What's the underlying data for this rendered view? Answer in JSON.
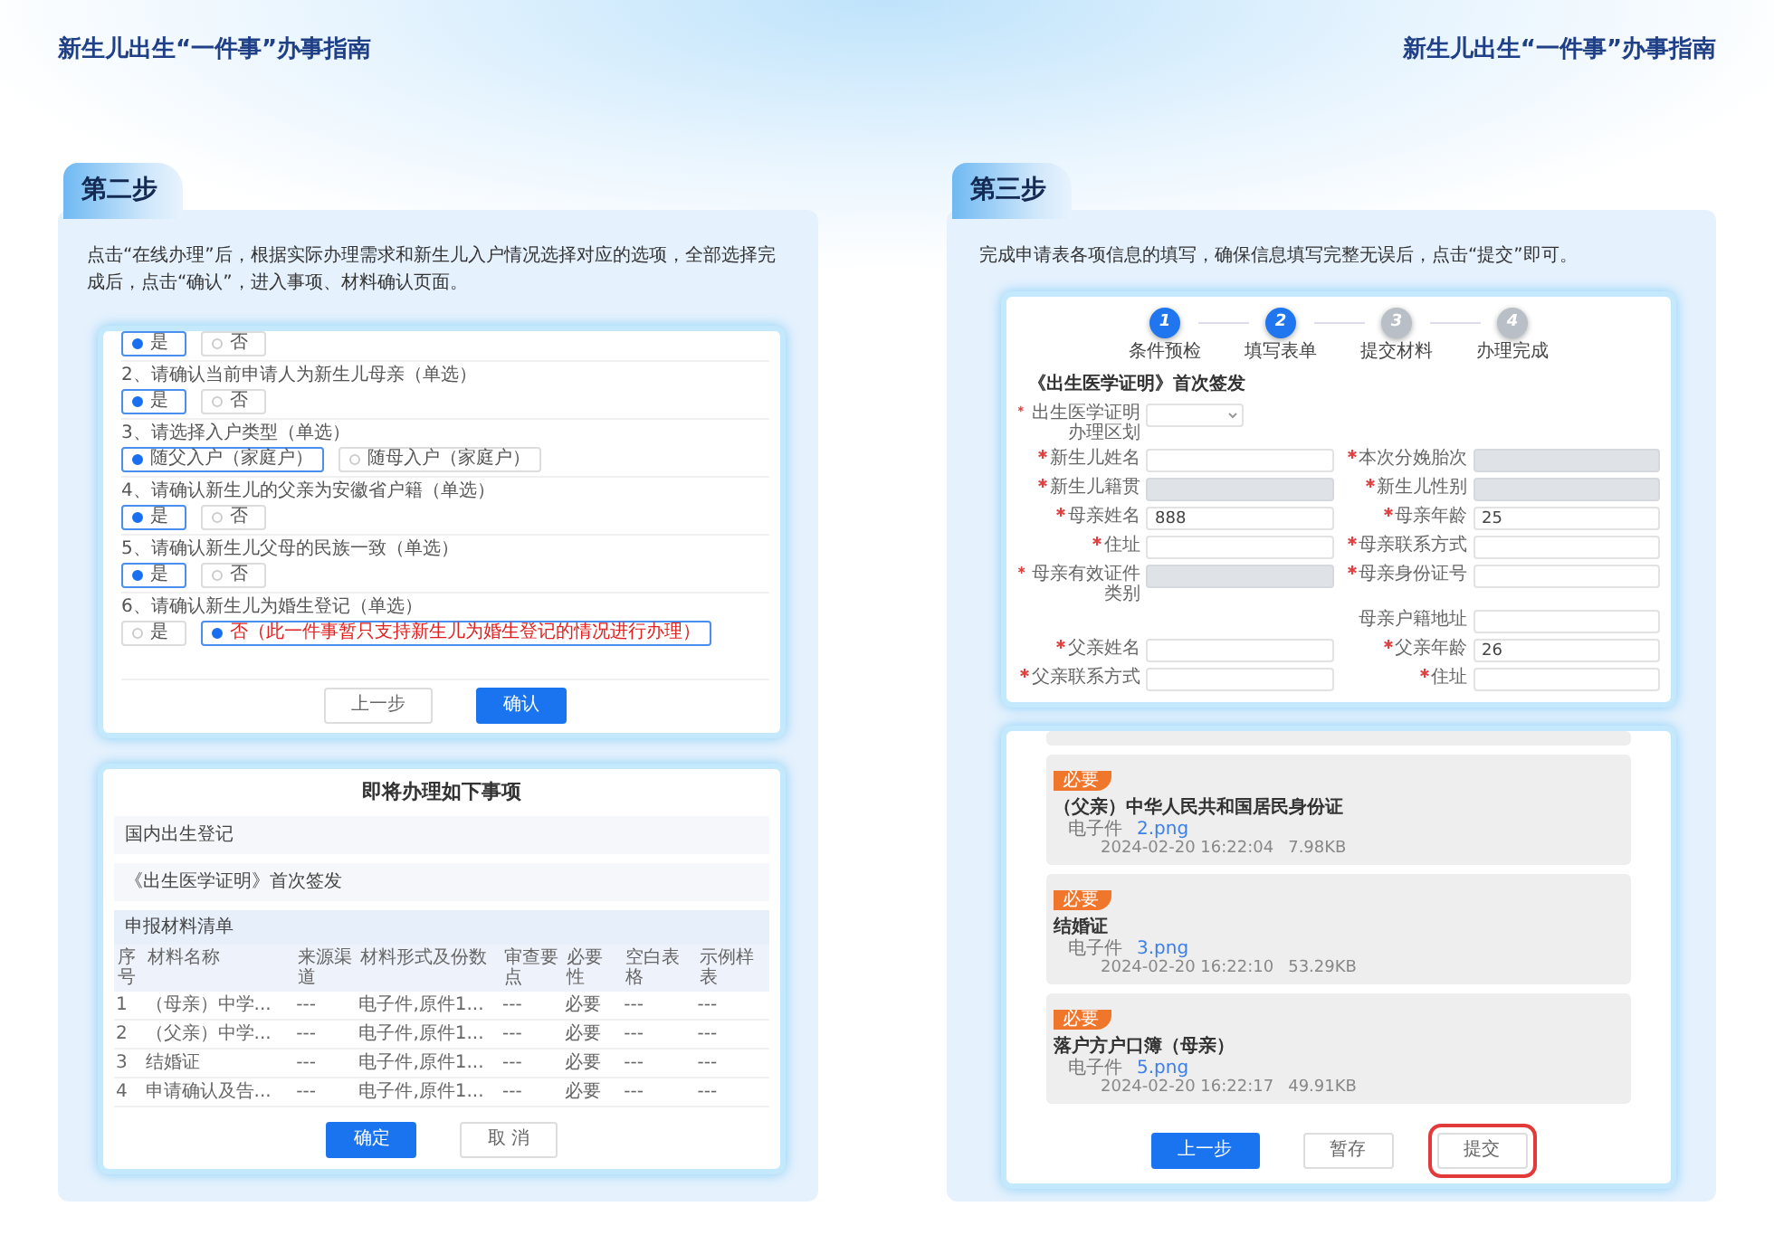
{
  "header": {
    "left_title": "新生儿出生“一件事”办事指南",
    "right_title": "新生儿出生“一件事”办事指南"
  },
  "step_two": {
    "tab": "第二步",
    "description": "点击“在线办理”后，根据实际办理需求和新生儿入户情况选择对应的选项，全部选择完成后，点击“确认”，进入事项、材料确认页面。",
    "questions": [
      {
        "options": [
          {
            "label": "是",
            "selected": true,
            "alert": false
          },
          {
            "label": "否",
            "selected": false,
            "alert": false
          }
        ]
      },
      {
        "text": "2、请确认当前申请人为新生儿母亲（单选）",
        "options": [
          {
            "label": "是",
            "selected": true,
            "alert": false
          },
          {
            "label": "否",
            "selected": false,
            "alert": false
          }
        ]
      },
      {
        "text": "3、请选择入户类型（单选）",
        "options": [
          {
            "label": "随父入户（家庭户）",
            "selected": true,
            "alert": false
          },
          {
            "label": "随母入户（家庭户）",
            "selected": false,
            "alert": false
          }
        ]
      },
      {
        "text": "4、请确认新生儿的父亲为安徽省户籍（单选）",
        "options": [
          {
            "label": "是",
            "selected": true,
            "alert": false
          },
          {
            "label": "否",
            "selected": false,
            "alert": false
          }
        ]
      },
      {
        "text": "5、请确认新生儿父母的民族一致（单选）",
        "options": [
          {
            "label": "是",
            "selected": true,
            "alert": false
          },
          {
            "label": "否",
            "selected": false,
            "alert": false
          }
        ]
      },
      {
        "text": "6、请确认新生儿为婚生登记（单选）",
        "options": [
          {
            "label": "是",
            "selected": false,
            "alert": false
          },
          {
            "label": "否（此一件事暂只支持新生儿为婚生登记的情况进行办理）",
            "selected": true,
            "alert": true
          }
        ]
      }
    ],
    "buttons": [
      {
        "label": "上一步",
        "primary": false
      },
      {
        "label": "确认",
        "primary": true
      }
    ],
    "confirm_dialog": {
      "title": "即将办理如下事项",
      "items": [
        "国内出生登记",
        "《出生医学证明》首次签发"
      ],
      "list_title": "申报材料清单",
      "columns": [
        "序号",
        "材料名称",
        "来源渠道",
        "材料形式及份数",
        "审查要点",
        "必要性",
        "空白表格",
        "示例样表"
      ],
      "rows": [
        [
          "1",
          "（母亲）中学...",
          "---",
          "电子件,原件1...",
          "---",
          "必要",
          "---",
          "---"
        ],
        [
          "2",
          "（父亲）中学...",
          "---",
          "电子件,原件1...",
          "---",
          "必要",
          "---",
          "---"
        ],
        [
          "3",
          "结婚证",
          "---",
          "电子件,原件1...",
          "---",
          "必要",
          "---",
          "---"
        ],
        [
          "4",
          "申请确认及告...",
          "---",
          "电子件,原件1...",
          "---",
          "必要",
          "---",
          "---"
        ]
      ],
      "buttons": [
        {
          "label": "确定",
          "primary": true
        },
        {
          "label": "取 消",
          "primary": false
        }
      ]
    }
  },
  "step_three": {
    "tab": "第三步",
    "description": "完成申请表各项信息的填写，确保信息填写完整无误后，点击“提交”即可。",
    "progress": [
      {
        "number": "1",
        "label": "条件预检",
        "done": true
      },
      {
        "number": "2",
        "label": "填写表单",
        "done": true
      },
      {
        "number": "3",
        "label": "提交材料",
        "done": false
      },
      {
        "number": "4",
        "label": "办理完成",
        "done": false
      }
    ],
    "form_title": "《出生医学证明》首次签发",
    "form_rows": [
      {
        "left": {
          "label": "出生医学证明办理区划",
          "required": true,
          "kind": "select"
        }
      },
      {
        "left": {
          "label": "新生儿姓名",
          "required": true,
          "kind": "input",
          "disabled": false
        },
        "right": {
          "label": "本次分娩胎次",
          "required": true,
          "kind": "input",
          "disabled": true
        }
      },
      {
        "left": {
          "label": "新生儿籍贯",
          "required": true,
          "kind": "input",
          "disabled": true
        },
        "right": {
          "label": "新生儿性别",
          "required": true,
          "kind": "input",
          "disabled": true
        }
      },
      {
        "left": {
          "label": "母亲姓名",
          "required": true,
          "kind": "input",
          "disabled": false,
          "value": "888"
        },
        "right": {
          "label": "母亲年龄",
          "required": true,
          "kind": "input",
          "disabled": false,
          "value": "25"
        }
      },
      {
        "left": {
          "label": "住址",
          "required": true,
          "kind": "input",
          "disabled": false
        },
        "right": {
          "label": "母亲联系方式",
          "required": true,
          "kind": "input",
          "disabled": false
        }
      },
      {
        "left": {
          "label": "母亲有效证件类别",
          "required": true,
          "kind": "input",
          "disabled": true
        },
        "right": {
          "label": "母亲身份证号",
          "required": true,
          "kind": "input",
          "disabled": false
        }
      },
      {
        "right": {
          "label": "母亲户籍地址",
          "required": false,
          "kind": "input",
          "disabled": false
        }
      },
      {
        "left": {
          "label": "父亲姓名",
          "required": true,
          "kind": "input",
          "disabled": false
        },
        "right": {
          "label": "父亲年龄",
          "required": true,
          "kind": "input",
          "disabled": false,
          "value": "26"
        }
      },
      {
        "left": {
          "label": "父亲联系方式",
          "required": true,
          "kind": "input",
          "disabled": false
        },
        "right": {
          "label": "住址",
          "required": true,
          "kind": "input",
          "disabled": false
        }
      }
    ],
    "materials": [
      {
        "badge": "必要",
        "title": "（父亲）中华人民共和国居民身份证",
        "file_type": "电子件",
        "file": "2.png",
        "time": "2024-02-20 16:22:04",
        "size": "7.98KB"
      },
      {
        "badge": "必要",
        "title": "结婚证",
        "file_type": "电子件",
        "file": "3.png",
        "time": "2024-02-20 16:22:10",
        "size": "53.29KB"
      },
      {
        "badge": "必要",
        "title": "落户方户口簿（母亲）",
        "file_type": "电子件",
        "file": "5.png",
        "time": "2024-02-20 16:22:17",
        "size": "49.91KB"
      }
    ],
    "buttons": [
      {
        "label": "上一步",
        "kind": "primary"
      },
      {
        "label": "暂存",
        "kind": "default"
      },
      {
        "label": "提交",
        "kind": "highlighted"
      }
    ]
  }
}
